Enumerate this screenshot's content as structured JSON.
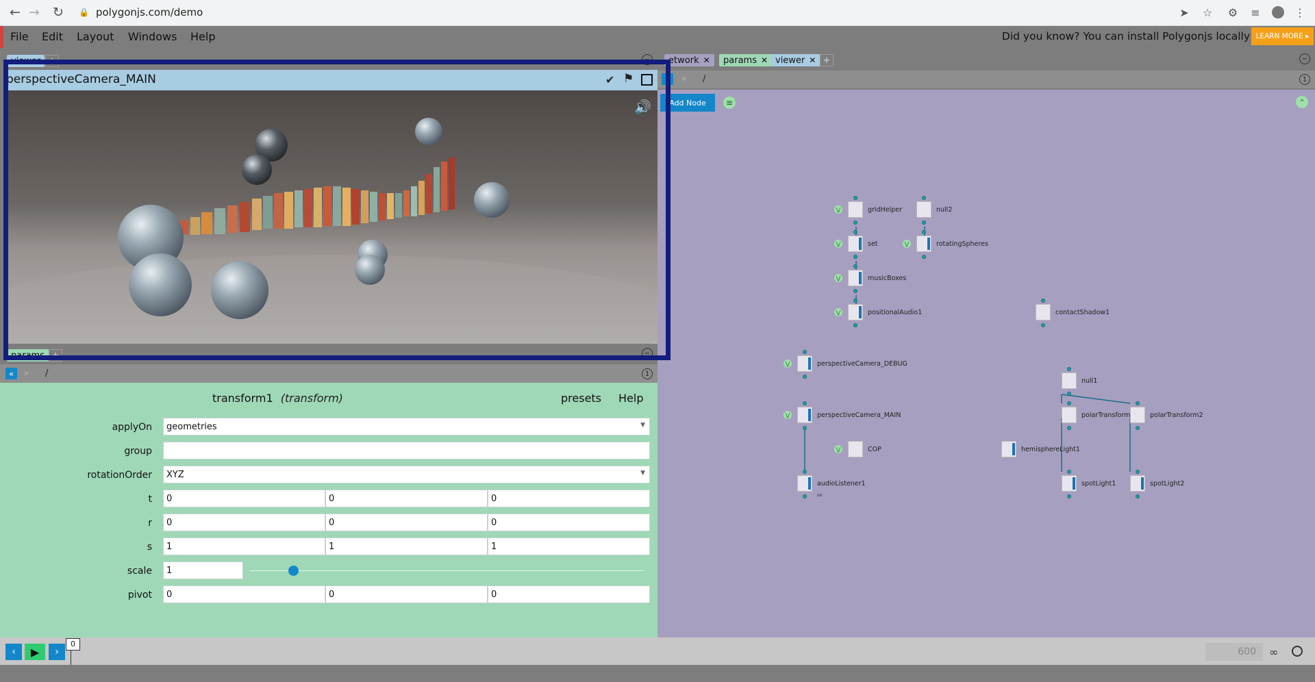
{
  "browser": {
    "url": "polygonjs.com/demo",
    "icons": [
      "back-arrow-icon",
      "forward-arrow-icon",
      "reload-icon",
      "lock-icon",
      "share-icon",
      "star-icon",
      "puzzle-icon",
      "reading-list-icon",
      "profile-icon",
      "kebab-menu-icon"
    ]
  },
  "menu": {
    "items": [
      "File",
      "Edit",
      "Layout",
      "Windows",
      "Help"
    ],
    "tip": "Did you know? You can install Polygonjs locally",
    "learn_more": "LEARN MORE ▸"
  },
  "viewer": {
    "tab_label": "viewer",
    "title": "perspectiveCamera_MAIN"
  },
  "params": {
    "tab_label": "params",
    "path": "/",
    "info_label": "1",
    "node_name": "transform1",
    "node_type": "(transform)",
    "presets_label": "presets",
    "help_label": "Help",
    "fields": {
      "applyOn": {
        "label": "applyOn",
        "value": "geometries"
      },
      "group": {
        "label": "group",
        "value": ""
      },
      "rotationOrder": {
        "label": "rotationOrder",
        "value": "XYZ"
      },
      "t": {
        "label": "t",
        "values": [
          "0",
          "0",
          "0"
        ]
      },
      "r": {
        "label": "r",
        "values": [
          "0",
          "0",
          "0"
        ]
      },
      "s": {
        "label": "s",
        "values": [
          "1",
          "1",
          "1"
        ]
      },
      "scale": {
        "label": "scale",
        "value": "1",
        "slider_fraction": 0.11
      },
      "pivot": {
        "label": "pivot",
        "values": [
          "0",
          "0",
          "0"
        ]
      }
    }
  },
  "network": {
    "tabs": [
      "etwork",
      "params",
      "viewer"
    ],
    "path": "/",
    "info_label": "1",
    "add_node_label": "Add Node",
    "nodes": {
      "gridHelper": "gridHelper",
      "null2": "null2",
      "set": "set",
      "rotatingSpheres": "rotatingSpheres",
      "musicBoxes": "musicBoxes",
      "positionalAudio1": "positionalAudio1",
      "contactShadow1": "contactShadow1",
      "perspectiveCamera_DEBUG": "perspectiveCamera_DEBUG",
      "null1": "null1",
      "perspectiveCamera_MAIN": "perspectiveCamera_MAIN",
      "polarTransform1": "polarTransform1",
      "polarTransform2": "polarTransform2",
      "COP": "COP",
      "hemisphereLight1": "hemisphereLight1",
      "audioListener1": "audioListener1",
      "spotLight1": "spotLight1",
      "spotLight2": "spotLight2"
    },
    "audio_listener_sub": "on"
  },
  "timeline": {
    "frame": "0",
    "end_frame": "600"
  },
  "colors": {
    "accent_blue": "#1387c9",
    "learn_more": "#f6a01a",
    "params_bg": "#9fd8b7",
    "network_bg": "#a69fc0",
    "viewer_header": "#a8cce2",
    "highlight": "#121d7e",
    "play_green": "#2ecc71"
  }
}
